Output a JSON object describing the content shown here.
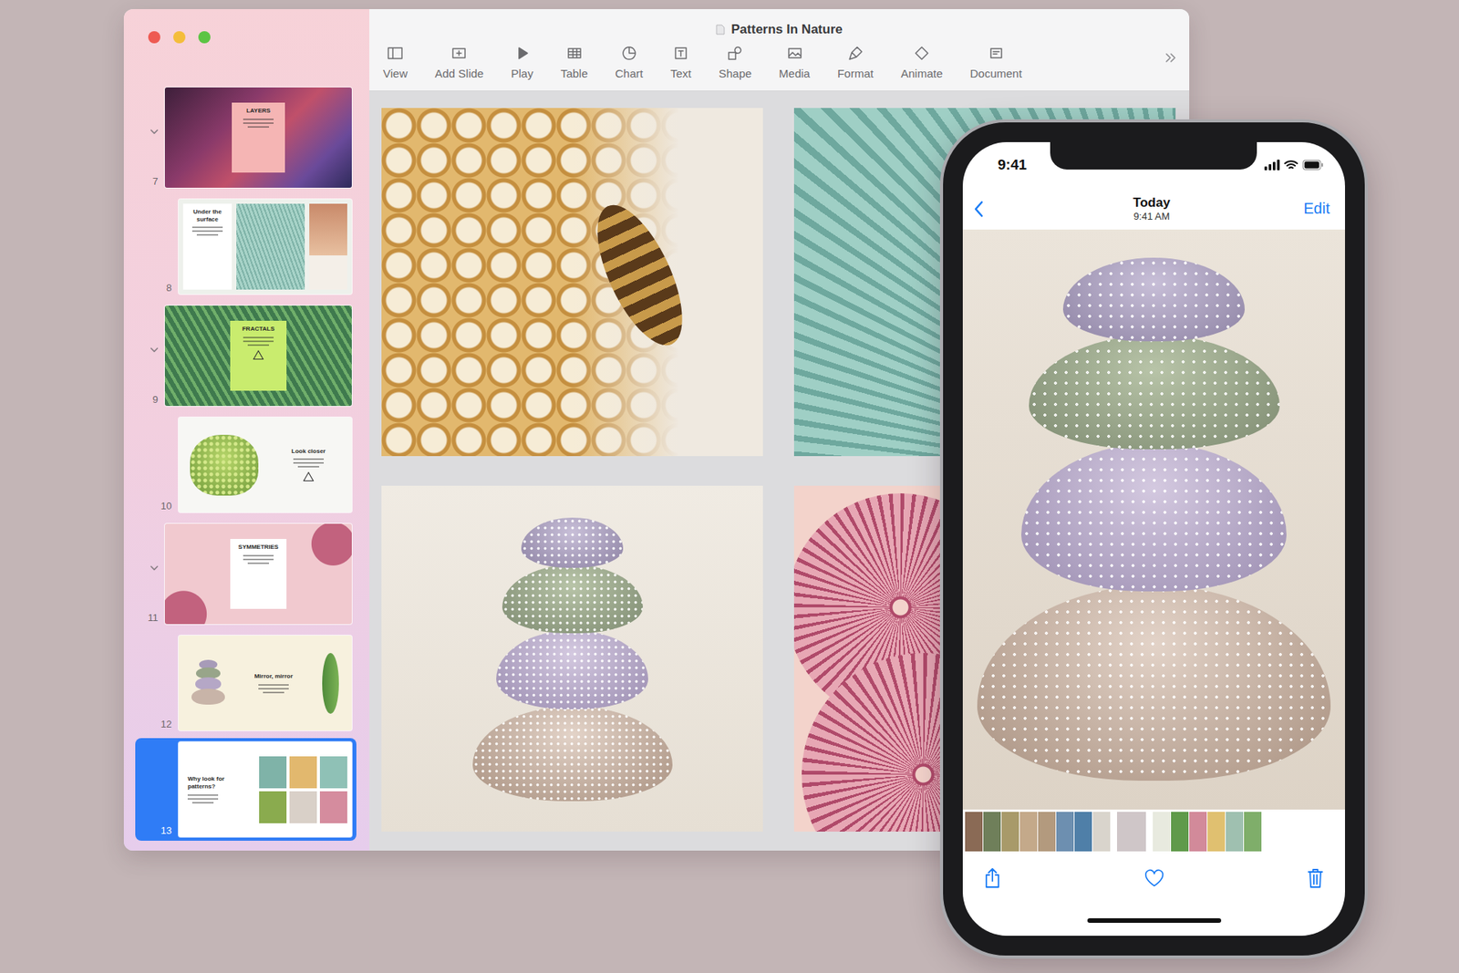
{
  "window": {
    "title": "Patterns In Nature"
  },
  "toolbar": [
    "View",
    "Add Slide",
    "Play",
    "Table",
    "Chart",
    "Text",
    "Shape",
    "Media",
    "Format",
    "Animate",
    "Document"
  ],
  "slides": [
    {
      "number": "7",
      "title": "LAYERS",
      "kind": "group",
      "expanded": true,
      "selected": false
    },
    {
      "number": "8",
      "title": "Under the surface",
      "kind": "child",
      "selected": false
    },
    {
      "number": "9",
      "title": "FRACTALS",
      "kind": "group",
      "expanded": true,
      "selected": false
    },
    {
      "number": "10",
      "title": "Look closer",
      "kind": "child",
      "selected": false
    },
    {
      "number": "11",
      "title": "SYMMETRIES",
      "kind": "group",
      "expanded": true,
      "selected": false
    },
    {
      "number": "12",
      "title": "Mirror, mirror",
      "kind": "child",
      "selected": false
    },
    {
      "number": "13",
      "title": "Why look for patterns?",
      "kind": "child",
      "selected": true
    }
  ],
  "phone": {
    "time": "9:41",
    "title": "Today",
    "subtitle": "9:41 AM",
    "action": "Edit",
    "favorite": false,
    "strip": [
      {
        "color": "#8a6a55",
        "selected": false
      },
      {
        "color": "#6f7f5a",
        "selected": false
      },
      {
        "color": "#a89a6a",
        "selected": false
      },
      {
        "color": "#c4a98a",
        "selected": false
      },
      {
        "color": "#b39a7e",
        "selected": false
      },
      {
        "color": "#6d8fb0",
        "selected": false
      },
      {
        "color": "#4f7fa8",
        "selected": false
      },
      {
        "color": "#d9d4cc",
        "selected": false
      },
      {
        "color": "#cfc6c8",
        "selected": true
      },
      {
        "color": "#e8eadf",
        "selected": false
      },
      {
        "color": "#5f9a4a",
        "selected": false
      },
      {
        "color": "#d28a9a",
        "selected": false
      },
      {
        "color": "#e0c070",
        "selected": false
      },
      {
        "color": "#9fc0b0",
        "selected": false
      },
      {
        "color": "#7fae6a",
        "selected": false
      }
    ]
  }
}
